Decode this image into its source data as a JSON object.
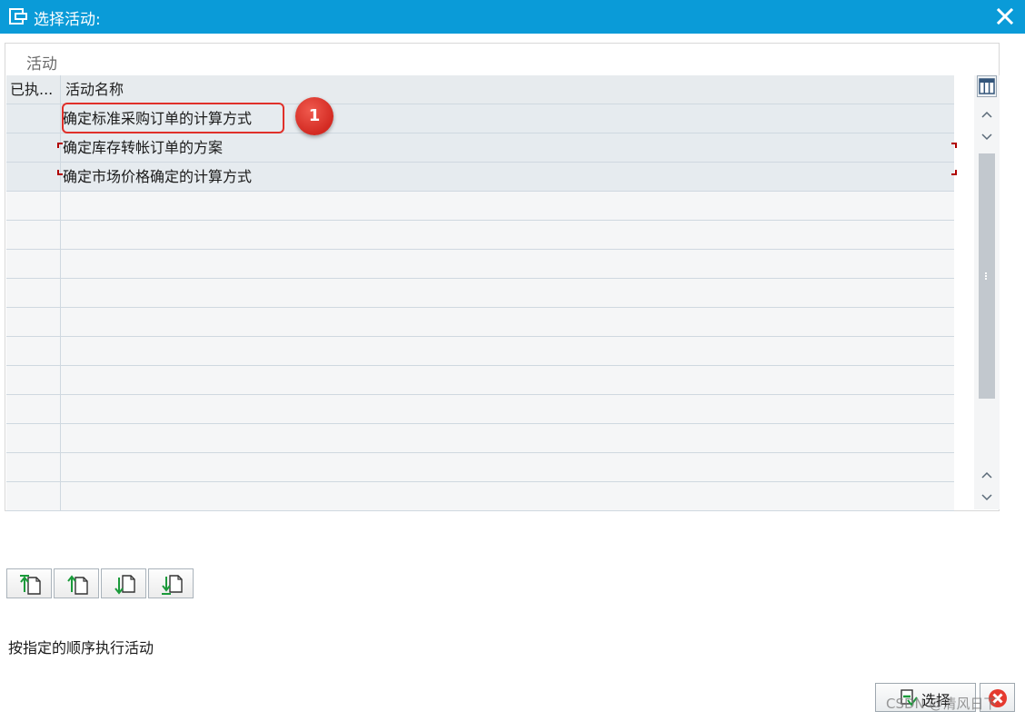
{
  "window": {
    "title": "选择活动:"
  },
  "group": {
    "label": "活动"
  },
  "table": {
    "columns": [
      "已执...",
      "活动名称"
    ],
    "rows": [
      {
        "executed": "",
        "name": "确定标准采购订单的计算方式"
      },
      {
        "executed": "",
        "name": "确定库存转帐订单的方案"
      },
      {
        "executed": "",
        "name": "确定市场价格确定的计算方式"
      }
    ]
  },
  "annotation": {
    "badge": "1"
  },
  "hint": "按指定的顺序执行活动",
  "buttons": {
    "select": "选择"
  },
  "watermark": "CSDN @清风日下",
  "colors": {
    "titlebar": "#0a9bd8",
    "highlight": "#e0302a",
    "badge": "#d32a22"
  },
  "icons": [
    "window-icon",
    "close-icon",
    "column-settings-icon",
    "scroll-up-icon",
    "scroll-down-icon",
    "move-to-top-icon",
    "move-up-icon",
    "move-down-icon",
    "move-to-bottom-icon",
    "select-icon",
    "cancel-icon"
  ]
}
